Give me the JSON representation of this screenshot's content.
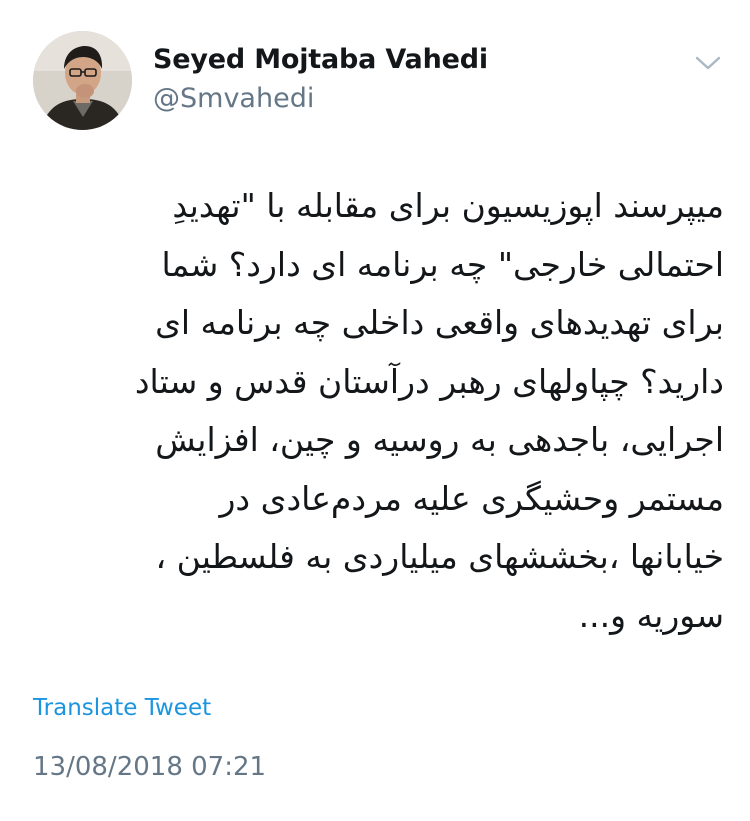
{
  "author": {
    "display_name": "Seyed Mojtaba Vahedi",
    "handle": "@Smvahedi",
    "avatar_icon": "profile-photo"
  },
  "menu": {
    "icon": "chevron-down-icon"
  },
  "tweet": {
    "lines": [
      "میپرسند اپوزیسیون برای مقابله با \"تهدیدِ",
      "احتمالی خارجی\" چه برنامه ای دارد؟ شما",
      "برای تهدیدهای واقعی داخلی چه برنامه ای",
      "دارید؟  چپاولهای رهبر درآستان قدس و ستاد",
      "اجرایی، باجدهی به روسیه و چین، افزایش",
      "مستمر وحشیگری  علیه مردم‌عادی در",
      "خیابانها ،بخششهای میلیاردی به فلسطین ،",
      "سوریه و..."
    ]
  },
  "translate_label": "Translate Tweet",
  "timestamp": "13/08/2018 07:21",
  "colors": {
    "link": "#1b95e0",
    "secondary": "#657786",
    "text": "#14171a"
  }
}
